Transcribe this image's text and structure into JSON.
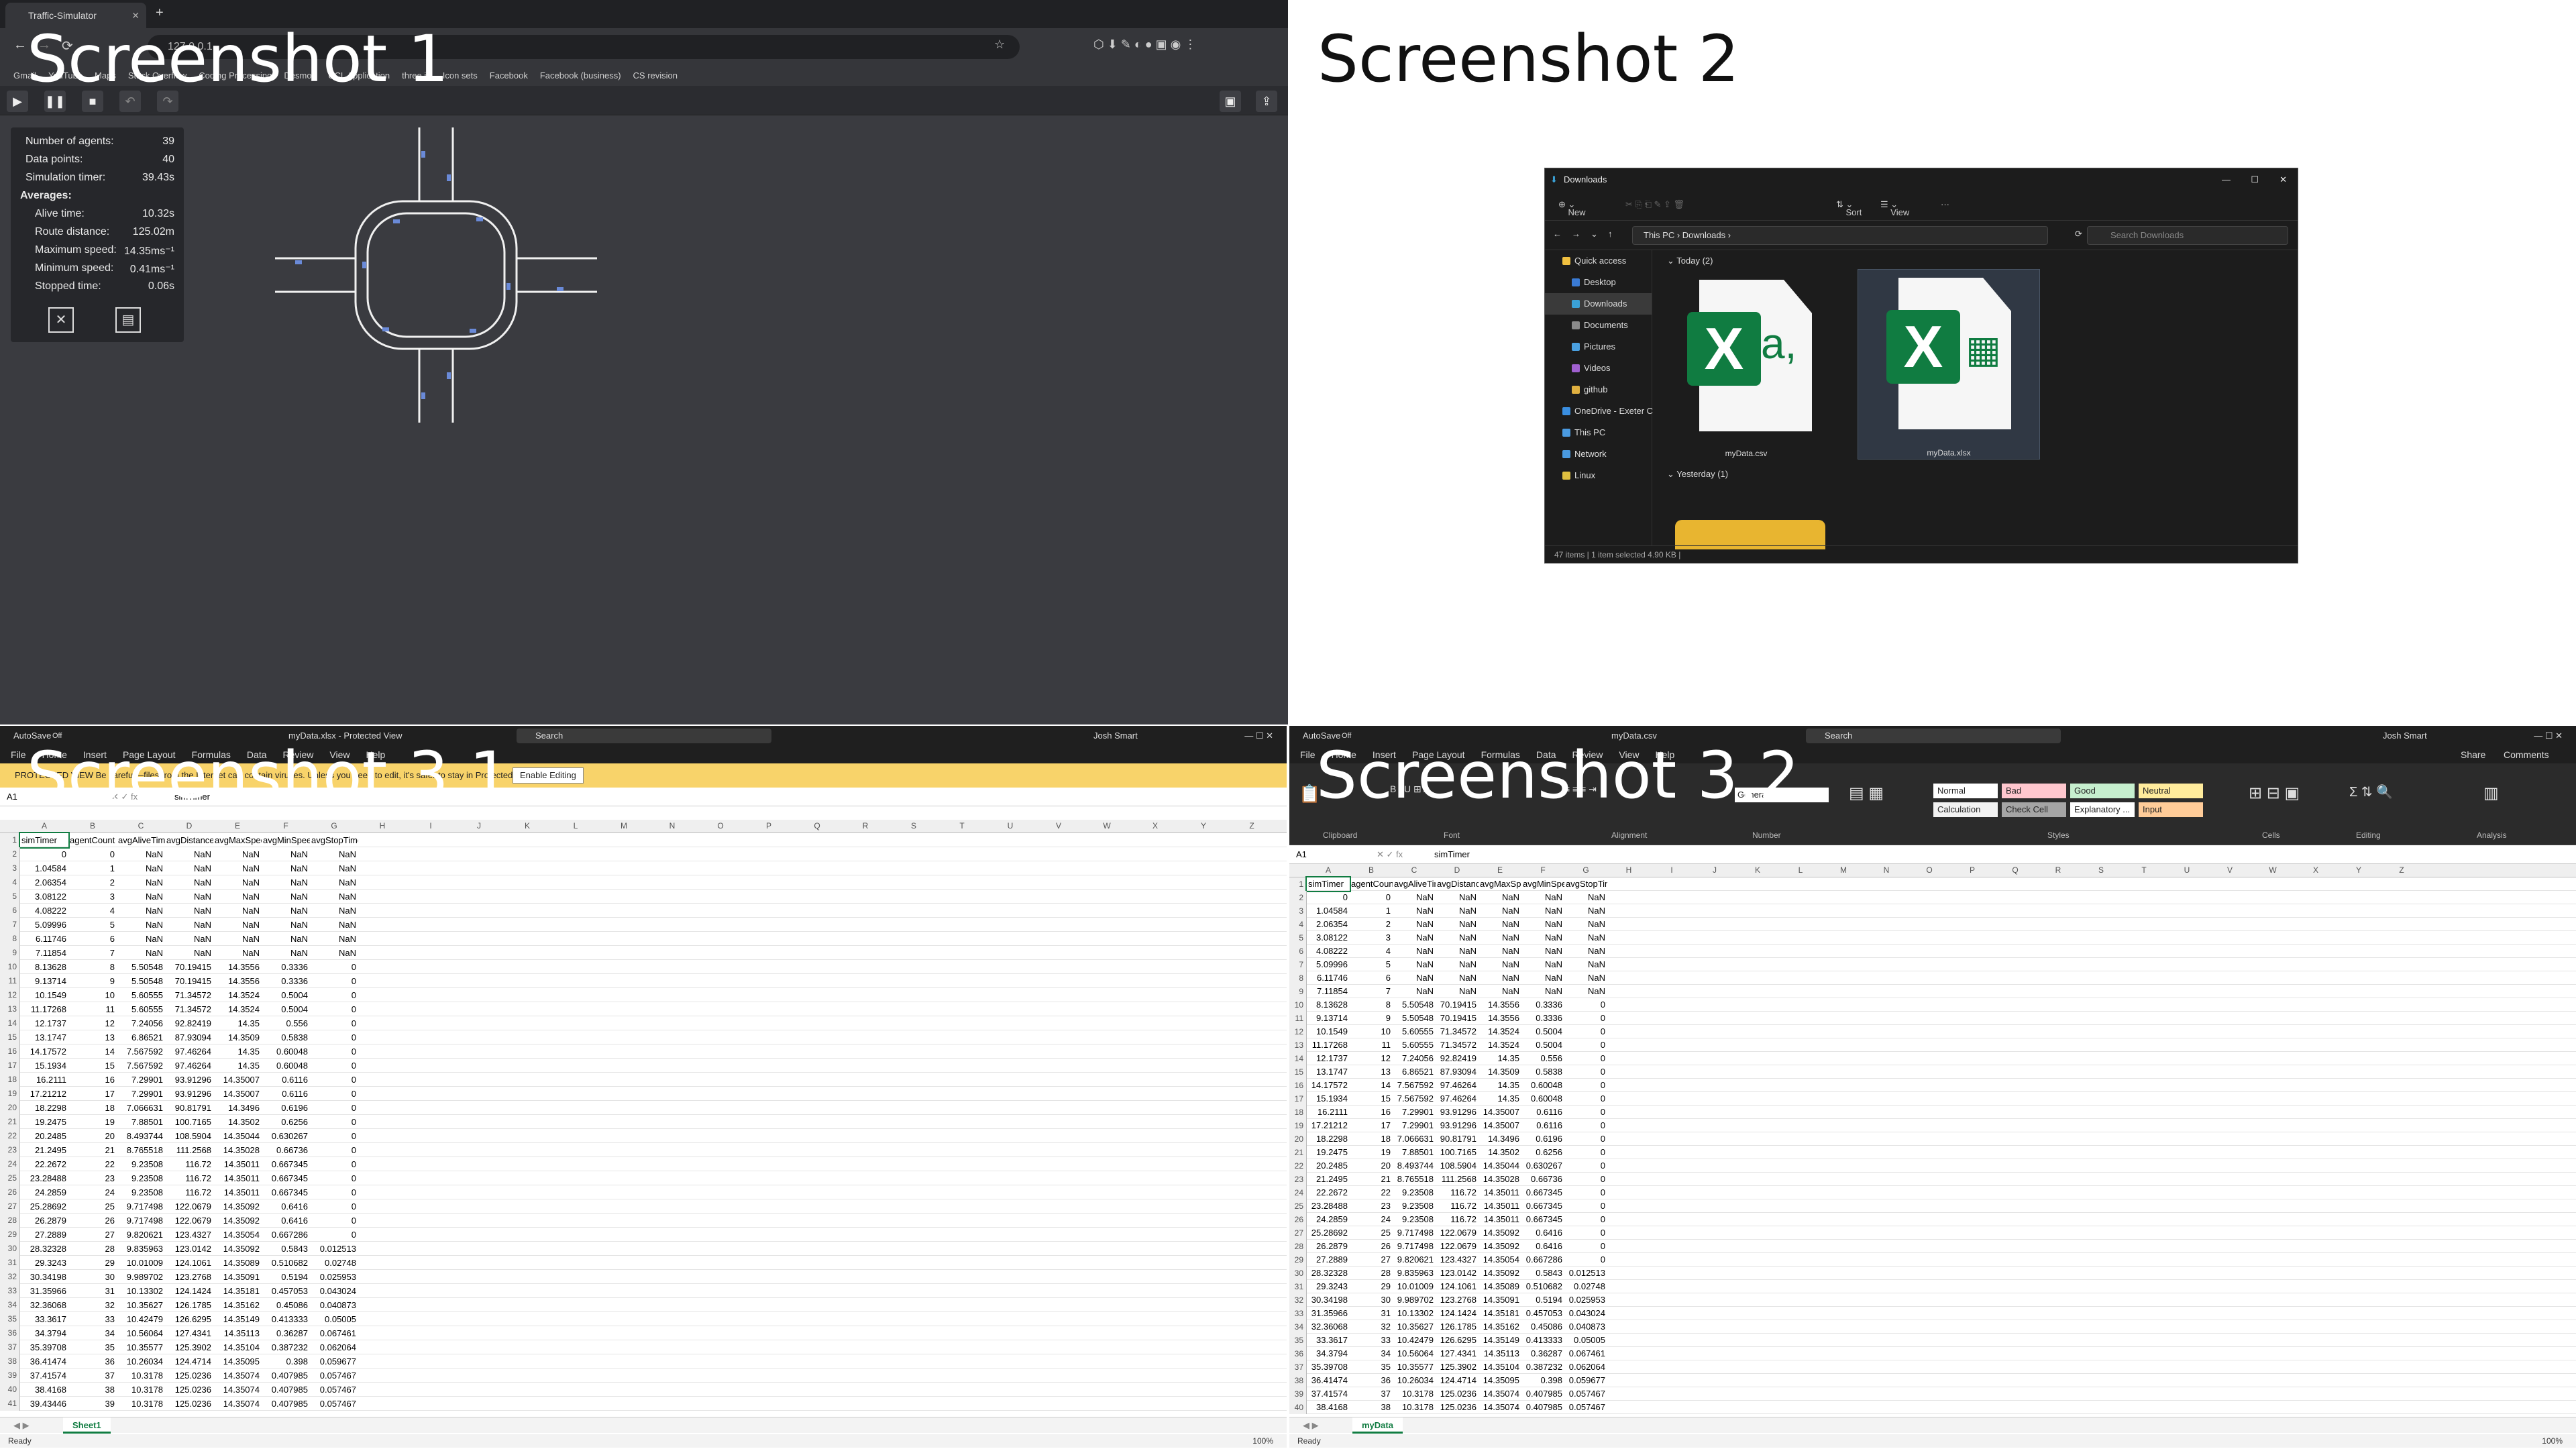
{
  "labels": {
    "s1": "Screenshot 1",
    "s2": "Screenshot 2",
    "s31": "Screenshot 3.1",
    "s32": "Screenshot 3.2"
  },
  "browser": {
    "tab_title": "Traffic-Simulator",
    "url": "127.0.0.1",
    "bookmarks": [
      "Gmail",
      "YouTube",
      "Maps",
      "Stack Overflow",
      "Coding Processing",
      "Desmos",
      "UCL Application",
      "three.js",
      "Icon sets",
      "Facebook",
      "Facebook (business)",
      "CS revision"
    ],
    "toolbar": [
      "play-icon",
      "pause-icon",
      "stop-icon",
      "undo-icon",
      "redo-icon"
    ],
    "stats": {
      "agents_label": "Number of agents:",
      "agents": "39",
      "points_label": "Data points:",
      "points": "40",
      "timer_label": "Simulation timer:",
      "timer": "39.43s",
      "averages_label": "Averages:",
      "alive_label": "Alive time:",
      "alive": "10.32s",
      "route_label": "Route distance:",
      "route": "125.02m",
      "max_label": "Maximum speed:",
      "max": "14.35ms⁻¹",
      "min_label": "Minimum speed:",
      "min": "0.41ms⁻¹",
      "stopped_label": "Stopped time:",
      "stopped": "0.06s"
    }
  },
  "explorer": {
    "title": "Downloads",
    "new": "New",
    "sort": "Sort",
    "view": "View",
    "breadcrumb": "This PC  ›  Downloads  ›",
    "search_placeholder": "Search Downloads",
    "nav": [
      {
        "label": "Quick access",
        "color": "#f0c040"
      },
      {
        "label": "Desktop",
        "color": "#3a7bd5"
      },
      {
        "label": "Downloads",
        "color": "#3aa0d5"
      },
      {
        "label": "Documents",
        "color": "#8a8a8a"
      },
      {
        "label": "Pictures",
        "color": "#4aa0e0"
      },
      {
        "label": "Videos",
        "color": "#a060d0"
      },
      {
        "label": "github",
        "color": "#e0b040"
      },
      {
        "label": "OneDrive - Exeter C",
        "color": "#3a8ee0"
      },
      {
        "label": "This PC",
        "color": "#4a9ae0"
      },
      {
        "label": "Network",
        "color": "#4a9ae0"
      },
      {
        "label": "Linux",
        "color": "#e0c040"
      }
    ],
    "group_today": "Today (2)",
    "group_yesterday": "Yesterday (1)",
    "file1": "myData.csv",
    "file2": "myData.xlsx",
    "status": "47 items  |  1 item selected  4.90 KB  |"
  },
  "excel": {
    "autosave": "AutoSave",
    "autosave_state": "Off",
    "title1": "myData.xlsx - Protected View",
    "title2": "myData.csv",
    "search": "Search",
    "user": "Josh Smart",
    "menu": [
      "File",
      "Home",
      "Insert",
      "Page Layout",
      "Formulas",
      "Data",
      "Review",
      "View",
      "Help"
    ],
    "protected_msg": "PROTECTED VIEW  Be careful—files from the Internet can contain viruses. Unless you need to edit, it's safer to stay in Protected View.",
    "enable_btn": "Enable Editing",
    "cell_ref": "A1",
    "formula": "simTimer",
    "sheet1": "Sheet1",
    "sheet2": "myData",
    "ready": "Ready",
    "zoom": "100%",
    "share": "Share",
    "comments": "Comments",
    "number_format": "General",
    "styles": [
      {
        "n": "Normal",
        "c": "#ffffff"
      },
      {
        "n": "Bad",
        "c": "#ffc7ce"
      },
      {
        "n": "Good",
        "c": "#c6efce"
      },
      {
        "n": "Neutral",
        "c": "#ffeb9c"
      },
      {
        "n": "Calculation",
        "c": "#f2f2f2"
      },
      {
        "n": "Check Cell",
        "c": "#a5a5a5"
      },
      {
        "n": "Explanatory ...",
        "c": "#ffffff"
      },
      {
        "n": "Input",
        "c": "#ffcc99"
      }
    ],
    "ribbon_groups": [
      "Clipboard",
      "Font",
      "Alignment",
      "Number",
      "Styles",
      "Cells",
      "Editing",
      "Analysis"
    ],
    "columns": [
      "A",
      "B",
      "C",
      "D",
      "E",
      "F",
      "G",
      "H",
      "I",
      "J",
      "K",
      "L",
      "M",
      "N",
      "O",
      "P",
      "Q",
      "R",
      "S",
      "T",
      "U",
      "V",
      "W",
      "X",
      "Y",
      "Z"
    ],
    "headers": [
      "simTimer",
      "agentCount",
      "avgAliveTime",
      "avgDistance",
      "avgMaxSpeed",
      "avgMinSpeed",
      "avgStopTime"
    ],
    "rows": [
      [
        "0",
        "0",
        "NaN",
        "NaN",
        "NaN",
        "NaN",
        "NaN"
      ],
      [
        "1.04584",
        "1",
        "NaN",
        "NaN",
        "NaN",
        "NaN",
        "NaN"
      ],
      [
        "2.06354",
        "2",
        "NaN",
        "NaN",
        "NaN",
        "NaN",
        "NaN"
      ],
      [
        "3.08122",
        "3",
        "NaN",
        "NaN",
        "NaN",
        "NaN",
        "NaN"
      ],
      [
        "4.08222",
        "4",
        "NaN",
        "NaN",
        "NaN",
        "NaN",
        "NaN"
      ],
      [
        "5.09996",
        "5",
        "NaN",
        "NaN",
        "NaN",
        "NaN",
        "NaN"
      ],
      [
        "6.11746",
        "6",
        "NaN",
        "NaN",
        "NaN",
        "NaN",
        "NaN"
      ],
      [
        "7.11854",
        "7",
        "NaN",
        "NaN",
        "NaN",
        "NaN",
        "NaN"
      ],
      [
        "8.13628",
        "8",
        "5.50548",
        "70.19415",
        "14.3556",
        "0.3336",
        "0"
      ],
      [
        "9.13714",
        "9",
        "5.50548",
        "70.19415",
        "14.3556",
        "0.3336",
        "0"
      ],
      [
        "10.1549",
        "10",
        "5.60555",
        "71.34572",
        "14.3524",
        "0.5004",
        "0"
      ],
      [
        "11.17268",
        "11",
        "5.60555",
        "71.34572",
        "14.3524",
        "0.5004",
        "0"
      ],
      [
        "12.1737",
        "12",
        "7.24056",
        "92.82419",
        "14.35",
        "0.556",
        "0"
      ],
      [
        "13.1747",
        "13",
        "6.86521",
        "87.93094",
        "14.3509",
        "0.5838",
        "0"
      ],
      [
        "14.17572",
        "14",
        "7.567592",
        "97.46264",
        "14.35",
        "0.60048",
        "0"
      ],
      [
        "15.1934",
        "15",
        "7.567592",
        "97.46264",
        "14.35",
        "0.60048",
        "0"
      ],
      [
        "16.2111",
        "16",
        "7.29901",
        "93.91296",
        "14.35007",
        "0.6116",
        "0"
      ],
      [
        "17.21212",
        "17",
        "7.29901",
        "93.91296",
        "14.35007",
        "0.6116",
        "0"
      ],
      [
        "18.2298",
        "18",
        "7.066631",
        "90.81791",
        "14.3496",
        "0.6196",
        "0"
      ],
      [
        "19.2475",
        "19",
        "7.88501",
        "100.7165",
        "14.3502",
        "0.6256",
        "0"
      ],
      [
        "20.2485",
        "20",
        "8.493744",
        "108.5904",
        "14.35044",
        "0.630267",
        "0"
      ],
      [
        "21.2495",
        "21",
        "8.765518",
        "111.2568",
        "14.35028",
        "0.66736",
        "0"
      ],
      [
        "22.2672",
        "22",
        "9.23508",
        "116.72",
        "14.35011",
        "0.667345",
        "0"
      ],
      [
        "23.28488",
        "23",
        "9.23508",
        "116.72",
        "14.35011",
        "0.667345",
        "0"
      ],
      [
        "24.2859",
        "24",
        "9.23508",
        "116.72",
        "14.35011",
        "0.667345",
        "0"
      ],
      [
        "25.28692",
        "25",
        "9.717498",
        "122.0679",
        "14.35092",
        "0.6416",
        "0"
      ],
      [
        "26.2879",
        "26",
        "9.717498",
        "122.0679",
        "14.35092",
        "0.6416",
        "0"
      ],
      [
        "27.2889",
        "27",
        "9.820621",
        "123.4327",
        "14.35054",
        "0.667286",
        "0"
      ],
      [
        "28.32328",
        "28",
        "9.835963",
        "123.0142",
        "14.35092",
        "0.5843",
        "0.012513"
      ],
      [
        "29.3243",
        "29",
        "10.01009",
        "124.1061",
        "14.35089",
        "0.510682",
        "0.02748"
      ],
      [
        "30.34198",
        "30",
        "9.989702",
        "123.2768",
        "14.35091",
        "0.5194",
        "0.025953"
      ],
      [
        "31.35966",
        "31",
        "10.13302",
        "124.1424",
        "14.35181",
        "0.457053",
        "0.043024"
      ],
      [
        "32.36068",
        "32",
        "10.35627",
        "126.1785",
        "14.35162",
        "0.45086",
        "0.040873"
      ],
      [
        "33.3617",
        "33",
        "10.42479",
        "126.6295",
        "14.35149",
        "0.413333",
        "0.05005"
      ],
      [
        "34.3794",
        "34",
        "10.56064",
        "127.4341",
        "14.35113",
        "0.36287",
        "0.067461"
      ],
      [
        "35.39708",
        "35",
        "10.35577",
        "125.3902",
        "14.35104",
        "0.387232",
        "0.062064"
      ],
      [
        "36.41474",
        "36",
        "10.26034",
        "124.4714",
        "14.35095",
        "0.398",
        "0.059677"
      ],
      [
        "37.41574",
        "37",
        "10.3178",
        "125.0236",
        "14.35074",
        "0.407985",
        "0.057467"
      ],
      [
        "38.4168",
        "38",
        "10.3178",
        "125.0236",
        "14.35074",
        "0.407985",
        "0.057467"
      ],
      [
        "39.43446",
        "39",
        "10.3178",
        "125.0236",
        "14.35074",
        "0.407985",
        "0.057467"
      ]
    ]
  }
}
